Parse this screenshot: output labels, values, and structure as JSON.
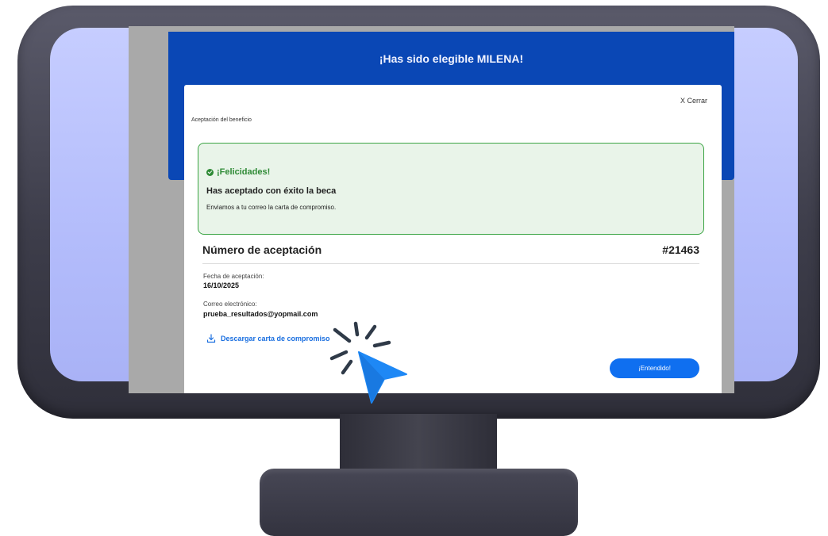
{
  "header": {
    "title": "¡Has sido elegible MILENA!"
  },
  "modal": {
    "close_label": "X Cerrar",
    "section_label": "Aceptación del beneficio",
    "success": {
      "heading": "¡Felicidades!",
      "title": "Has aceptado con éxito la beca",
      "message": "Enviamos a tu correo la carta de compromiso."
    },
    "acceptance": {
      "label": "Número de aceptación",
      "number": "#21463"
    },
    "date": {
      "label": "Fecha de aceptación:",
      "value": "16/10/2025"
    },
    "email": {
      "label": "Correo electrónico:",
      "value": "prueba_resultados@yopmail.com"
    },
    "download_label": "Descargar carta de compromiso",
    "confirm_label": "¡Entendido!"
  },
  "colors": {
    "header_blue": "#0a47b5",
    "success_green": "#2e8a35",
    "success_bg": "#e9f4e9",
    "link_blue": "#1a6fe0",
    "button_blue": "#0f6ff0",
    "monitor_bezel": "#b3bcfb",
    "cursor_blue": "#1e88f5"
  },
  "icons": {
    "success": "check-circle-icon",
    "download": "download-icon",
    "cursor": "pointer-cursor-icon"
  }
}
